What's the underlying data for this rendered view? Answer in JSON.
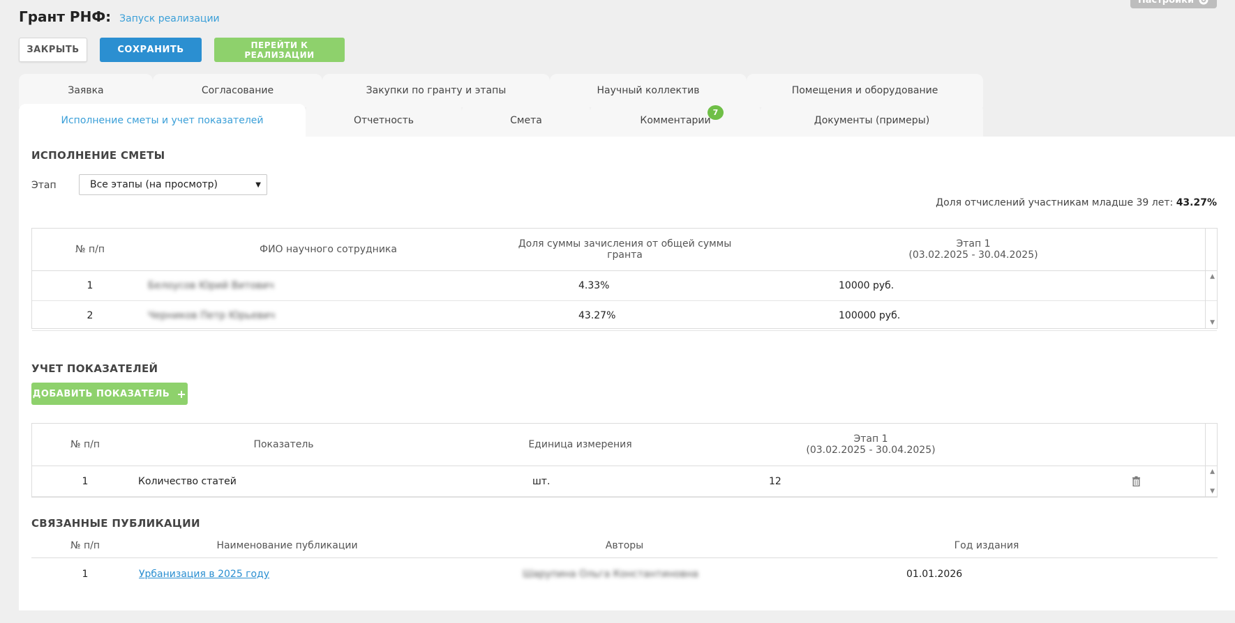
{
  "topbar": {
    "settings_label": "Настройки"
  },
  "header": {
    "title": "Грант РНФ:",
    "subtitle": "Запуск реализации"
  },
  "actions": {
    "close_label": "ЗАКРЫТЬ",
    "save_label": "СОХРАНИТЬ",
    "go_label": "ПЕРЕЙТИ К РЕАЛИЗАЦИИ"
  },
  "tabs_row1": [
    {
      "label": "Заявка"
    },
    {
      "label": "Согласование"
    },
    {
      "label": "Закупки по гранту и этапы"
    },
    {
      "label": "Научный коллектив"
    },
    {
      "label": "Помещения и оборудование"
    }
  ],
  "tabs_row2": [
    {
      "label": "Исполнение сметы и учет показателей",
      "active": true
    },
    {
      "label": "Отчетность"
    },
    {
      "label": "Смета"
    },
    {
      "label": "Комментарии",
      "badge": "7"
    },
    {
      "label": "Документы (примеры)"
    }
  ],
  "estimate": {
    "section_title": "ИСПОЛНЕНИЕ СМЕТЫ",
    "stage_label": "Этап",
    "stage_value": "Все этапы (на просмотр)",
    "share_label": "Доля отчислений участникам младше 39 лет:",
    "share_value": "43.27%",
    "columns": [
      "№ п/п",
      "ФИО научного сотрудника",
      "Доля суммы зачисления от общей суммы гранта",
      "Этап 1",
      "(03.02.2025 - 30.04.2025)"
    ],
    "rows": [
      {
        "num": "1",
        "name": "Белоусов Юрий Витович",
        "share": "4.33%",
        "amount": "10000 руб."
      },
      {
        "num": "2",
        "name": "Черников Петр Юрьевич",
        "share": "43.27%",
        "amount": "100000 руб."
      }
    ]
  },
  "indicators": {
    "section_title": "УЧЕТ ПОКАЗАТЕЛЕЙ",
    "add_label": "ДОБАВИТЬ ПОКАЗАТЕЛЬ",
    "columns": [
      "№ п/п",
      "Показатель",
      "Единица измерения",
      "Этап 1",
      "(03.02.2025 - 30.04.2025)"
    ],
    "rows": [
      {
        "num": "1",
        "name": "Количество статей",
        "unit": "шт.",
        "value": "12"
      }
    ]
  },
  "publications": {
    "section_title": "СВЯЗАННЫЕ ПУБЛИКАЦИИ",
    "columns": [
      "№ п/п",
      "Наименование публикации",
      "Авторы",
      "Год издания"
    ],
    "rows": [
      {
        "num": "1",
        "title": "Урбанизация в 2025 году",
        "authors": "Шарупина Ольга Константиновна",
        "year": "01.01.2026"
      }
    ]
  }
}
